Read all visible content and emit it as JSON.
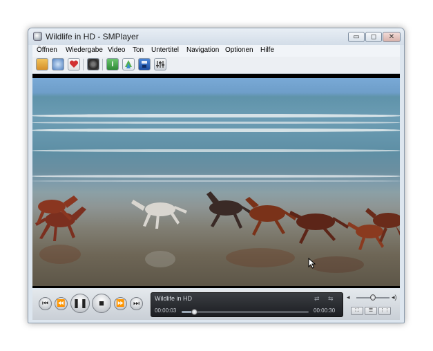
{
  "window": {
    "title": "Wildlife in HD - SMPlayer",
    "icon": "smplayer-app-icon",
    "buttons": {
      "minimize": "▭",
      "maximize": "◻",
      "close": "✕"
    }
  },
  "menu": {
    "items": [
      "Öffnen",
      "Wiedergabe",
      "Video",
      "Ton",
      "Untertitel",
      "Navigation",
      "Optionen",
      "Hilfe"
    ]
  },
  "toolbar": {
    "buttons": [
      {
        "name": "open-folder-icon",
        "color": "#e0a030"
      },
      {
        "name": "globe-icon",
        "color": "#4f7fc0"
      },
      {
        "name": "favorites-heart-icon",
        "color": "#c83a3a"
      },
      {
        "name": "dvd-disc-icon",
        "color": "#3a3a3a"
      },
      {
        "name": "info-icon",
        "color": "#3fa64a"
      },
      {
        "name": "subtitle-upload-icon",
        "color": "#4aa8d8"
      },
      {
        "name": "save-disk-icon",
        "color": "#2d62b8"
      },
      {
        "name": "equalizer-icon",
        "color": "#9aa0a8"
      }
    ]
  },
  "player": {
    "media_title": "Wildlife in HD",
    "elapsed": "00:00:03",
    "duration": "00:00:30",
    "progress": 0.1,
    "volume": 0.5,
    "buttons": {
      "prev": "⏮",
      "rewind": "⏪",
      "pause": "❚❚",
      "stop": "■",
      "forward": "⏩",
      "next": "⏭"
    },
    "panel_icons": {
      "repeat": "⇄",
      "shuffle": "⇆"
    },
    "volume_icons": {
      "mute": "◂",
      "loud": "◂)"
    },
    "small_buttons": {
      "fullscreen": "⛶",
      "playlist": "☰",
      "equalizer": "⋮⋮"
    }
  },
  "colors": {
    "sky": "#79a9d6",
    "sea": "#5e8fa5",
    "sand": "#6e6656",
    "wave": "#e9eef0"
  }
}
